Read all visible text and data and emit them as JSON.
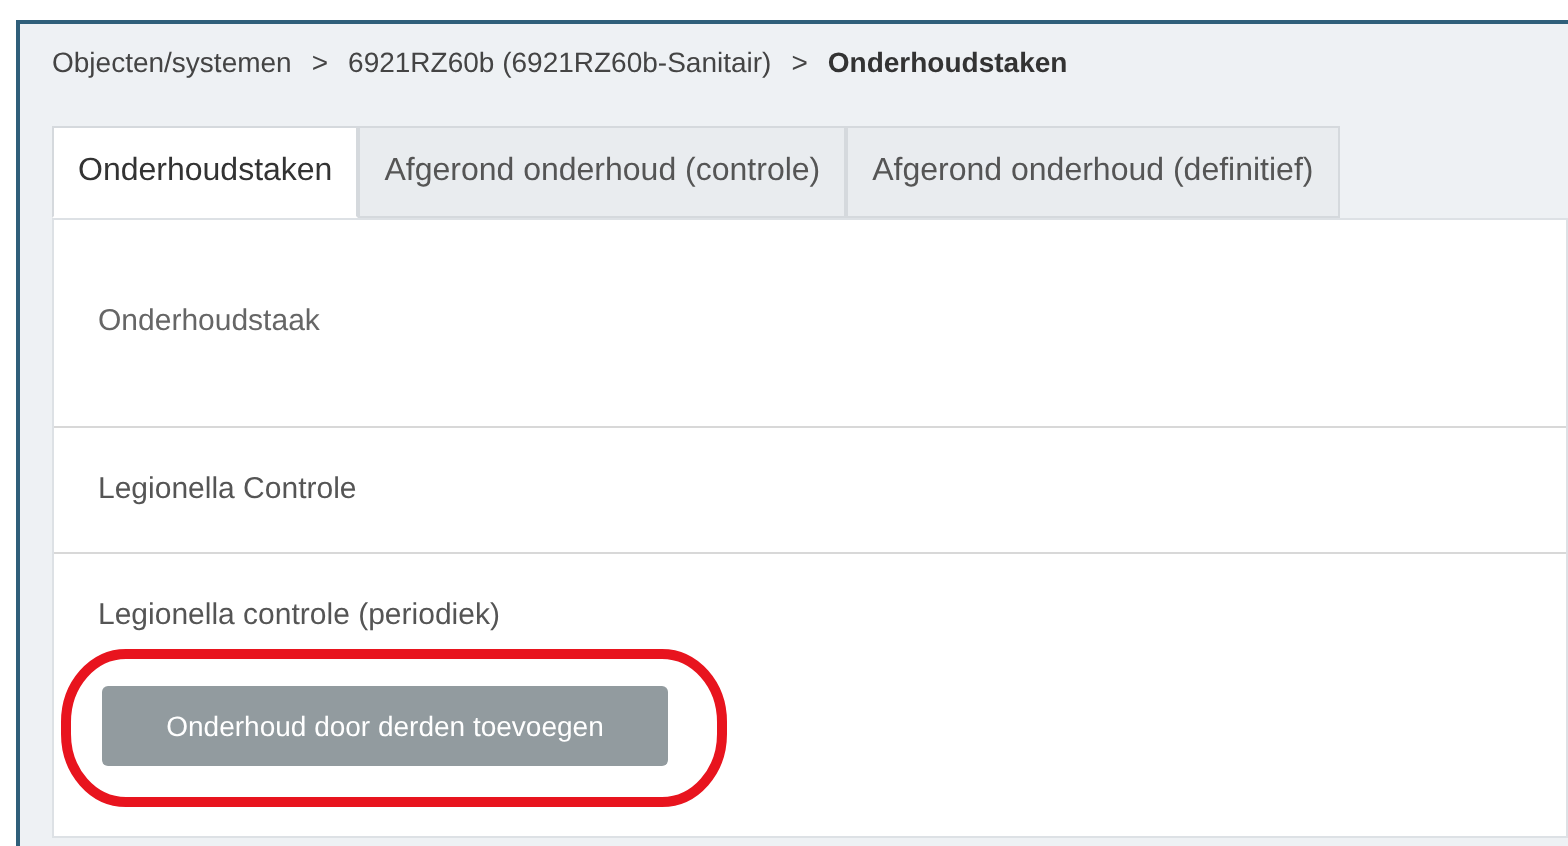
{
  "breadcrumb": [
    {
      "label": "Objecten/systemen",
      "current": false
    },
    {
      "label": "6921RZ60b (6921RZ60b-Sanitair)",
      "current": false
    },
    {
      "label": "Onderhoudstaken",
      "current": true
    }
  ],
  "breadcrumb_separator": ">",
  "tabs": [
    {
      "label": "Onderhoudstaken",
      "selected": true
    },
    {
      "label": "Afgerond onderhoud (controle)",
      "selected": false
    },
    {
      "label": "Afgerond onderhoud (definitief)",
      "selected": false
    }
  ],
  "table": {
    "columns": [
      "Onderhoudstaak"
    ],
    "rows": [
      "Legionella Controle",
      "Legionella controle (periodiek)"
    ]
  },
  "add_button": {
    "label": "Onderhoud door derden toevoegen",
    "disabled": true
  }
}
